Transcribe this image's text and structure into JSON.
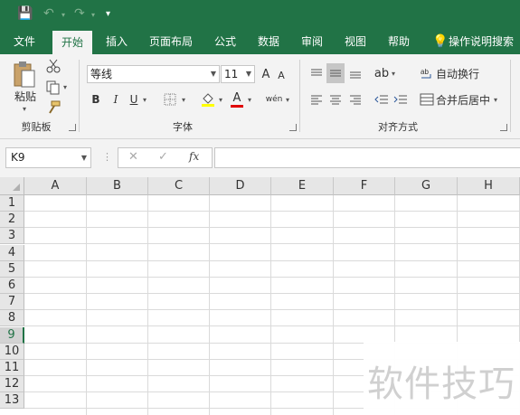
{
  "quick_access": {
    "save": "💾",
    "undo": "↶",
    "redo": "↷",
    "customize": "▾"
  },
  "tabs": [
    "文件",
    "开始",
    "插入",
    "页面布局",
    "公式",
    "数据",
    "审阅",
    "视图",
    "帮助"
  ],
  "tell_me": {
    "icon": "lightbulb-icon",
    "label": "操作说明搜索"
  },
  "ribbon": {
    "clipboard": {
      "label": "剪贴板",
      "paste": "粘贴"
    },
    "font": {
      "label": "字体",
      "name": "等线",
      "size": "11",
      "grow": "A",
      "shrink": "A",
      "bold": "B",
      "italic": "I",
      "underline": "U",
      "wen": "wén"
    },
    "alignment": {
      "label": "对齐方式",
      "wrap": "自动换行",
      "merge": "合并后居中"
    }
  },
  "formula_bar": {
    "name_box": "K9",
    "cancel": "✕",
    "enter": "✓",
    "fx": "fx",
    "value": ""
  },
  "columns": [
    "A",
    "B",
    "C",
    "D",
    "E",
    "F",
    "G",
    "H"
  ],
  "rows": [
    "1",
    "2",
    "3",
    "4",
    "5",
    "6",
    "7",
    "8",
    "9",
    "10",
    "11",
    "12",
    "13"
  ],
  "selected_row": "9",
  "watermark": "软件技巧",
  "colors": {
    "accent": "#217346",
    "ribbon_bg": "#f3f3f3"
  }
}
